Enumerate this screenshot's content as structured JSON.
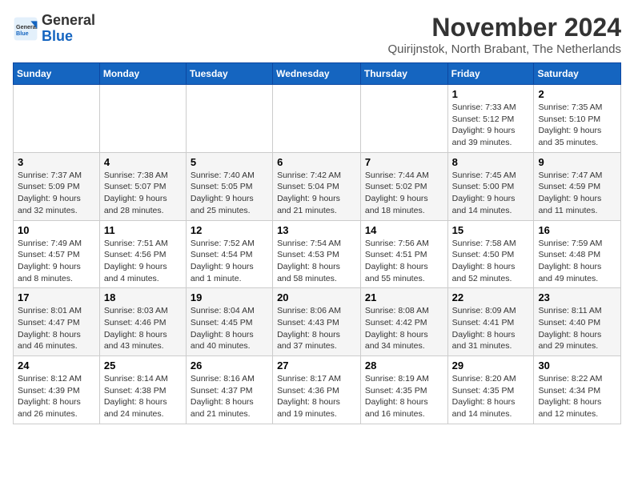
{
  "logo": {
    "general": "General",
    "blue": "Blue"
  },
  "title": "November 2024",
  "location": "Quirijnstok, North Brabant, The Netherlands",
  "weekdays": [
    "Sunday",
    "Monday",
    "Tuesday",
    "Wednesday",
    "Thursday",
    "Friday",
    "Saturday"
  ],
  "weeks": [
    [
      {
        "day": "",
        "info": ""
      },
      {
        "day": "",
        "info": ""
      },
      {
        "day": "",
        "info": ""
      },
      {
        "day": "",
        "info": ""
      },
      {
        "day": "",
        "info": ""
      },
      {
        "day": "1",
        "info": "Sunrise: 7:33 AM\nSunset: 5:12 PM\nDaylight: 9 hours and 39 minutes."
      },
      {
        "day": "2",
        "info": "Sunrise: 7:35 AM\nSunset: 5:10 PM\nDaylight: 9 hours and 35 minutes."
      }
    ],
    [
      {
        "day": "3",
        "info": "Sunrise: 7:37 AM\nSunset: 5:09 PM\nDaylight: 9 hours and 32 minutes."
      },
      {
        "day": "4",
        "info": "Sunrise: 7:38 AM\nSunset: 5:07 PM\nDaylight: 9 hours and 28 minutes."
      },
      {
        "day": "5",
        "info": "Sunrise: 7:40 AM\nSunset: 5:05 PM\nDaylight: 9 hours and 25 minutes."
      },
      {
        "day": "6",
        "info": "Sunrise: 7:42 AM\nSunset: 5:04 PM\nDaylight: 9 hours and 21 minutes."
      },
      {
        "day": "7",
        "info": "Sunrise: 7:44 AM\nSunset: 5:02 PM\nDaylight: 9 hours and 18 minutes."
      },
      {
        "day": "8",
        "info": "Sunrise: 7:45 AM\nSunset: 5:00 PM\nDaylight: 9 hours and 14 minutes."
      },
      {
        "day": "9",
        "info": "Sunrise: 7:47 AM\nSunset: 4:59 PM\nDaylight: 9 hours and 11 minutes."
      }
    ],
    [
      {
        "day": "10",
        "info": "Sunrise: 7:49 AM\nSunset: 4:57 PM\nDaylight: 9 hours and 8 minutes."
      },
      {
        "day": "11",
        "info": "Sunrise: 7:51 AM\nSunset: 4:56 PM\nDaylight: 9 hours and 4 minutes."
      },
      {
        "day": "12",
        "info": "Sunrise: 7:52 AM\nSunset: 4:54 PM\nDaylight: 9 hours and 1 minute."
      },
      {
        "day": "13",
        "info": "Sunrise: 7:54 AM\nSunset: 4:53 PM\nDaylight: 8 hours and 58 minutes."
      },
      {
        "day": "14",
        "info": "Sunrise: 7:56 AM\nSunset: 4:51 PM\nDaylight: 8 hours and 55 minutes."
      },
      {
        "day": "15",
        "info": "Sunrise: 7:58 AM\nSunset: 4:50 PM\nDaylight: 8 hours and 52 minutes."
      },
      {
        "day": "16",
        "info": "Sunrise: 7:59 AM\nSunset: 4:48 PM\nDaylight: 8 hours and 49 minutes."
      }
    ],
    [
      {
        "day": "17",
        "info": "Sunrise: 8:01 AM\nSunset: 4:47 PM\nDaylight: 8 hours and 46 minutes."
      },
      {
        "day": "18",
        "info": "Sunrise: 8:03 AM\nSunset: 4:46 PM\nDaylight: 8 hours and 43 minutes."
      },
      {
        "day": "19",
        "info": "Sunrise: 8:04 AM\nSunset: 4:45 PM\nDaylight: 8 hours and 40 minutes."
      },
      {
        "day": "20",
        "info": "Sunrise: 8:06 AM\nSunset: 4:43 PM\nDaylight: 8 hours and 37 minutes."
      },
      {
        "day": "21",
        "info": "Sunrise: 8:08 AM\nSunset: 4:42 PM\nDaylight: 8 hours and 34 minutes."
      },
      {
        "day": "22",
        "info": "Sunrise: 8:09 AM\nSunset: 4:41 PM\nDaylight: 8 hours and 31 minutes."
      },
      {
        "day": "23",
        "info": "Sunrise: 8:11 AM\nSunset: 4:40 PM\nDaylight: 8 hours and 29 minutes."
      }
    ],
    [
      {
        "day": "24",
        "info": "Sunrise: 8:12 AM\nSunset: 4:39 PM\nDaylight: 8 hours and 26 minutes."
      },
      {
        "day": "25",
        "info": "Sunrise: 8:14 AM\nSunset: 4:38 PM\nDaylight: 8 hours and 24 minutes."
      },
      {
        "day": "26",
        "info": "Sunrise: 8:16 AM\nSunset: 4:37 PM\nDaylight: 8 hours and 21 minutes."
      },
      {
        "day": "27",
        "info": "Sunrise: 8:17 AM\nSunset: 4:36 PM\nDaylight: 8 hours and 19 minutes."
      },
      {
        "day": "28",
        "info": "Sunrise: 8:19 AM\nSunset: 4:35 PM\nDaylight: 8 hours and 16 minutes."
      },
      {
        "day": "29",
        "info": "Sunrise: 8:20 AM\nSunset: 4:35 PM\nDaylight: 8 hours and 14 minutes."
      },
      {
        "day": "30",
        "info": "Sunrise: 8:22 AM\nSunset: 4:34 PM\nDaylight: 8 hours and 12 minutes."
      }
    ]
  ]
}
